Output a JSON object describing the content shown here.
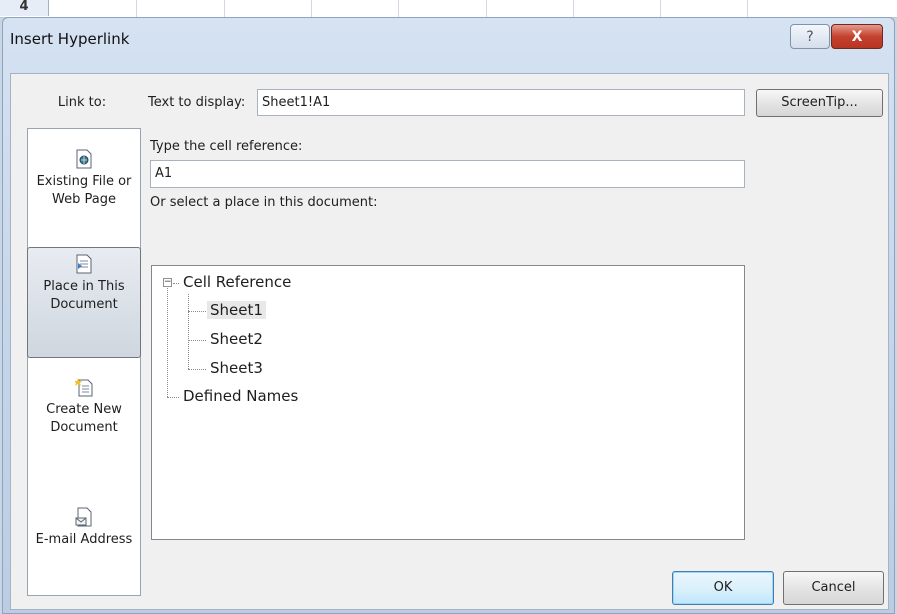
{
  "background_sheet": {
    "row_number": "4"
  },
  "window": {
    "title": "Insert Hyperlink",
    "help_label": "?",
    "close_label": "X"
  },
  "link_to": {
    "label": "Link to:",
    "items": [
      {
        "line1": "Existing File or",
        "line2": "Web Page",
        "icon": "web-page-icon",
        "selected": false
      },
      {
        "line1": "Place in This",
        "line2": "Document",
        "icon": "document-icon",
        "selected": true
      },
      {
        "line1": "Create New",
        "line2": "Document",
        "icon": "new-document-icon",
        "selected": false
      },
      {
        "line1": "E-mail Address",
        "line2": "",
        "icon": "email-icon",
        "selected": false
      }
    ]
  },
  "text_to_display": {
    "label": "Text to display:",
    "value": "Sheet1!A1"
  },
  "screentip_button": "ScreenTip...",
  "cell_reference": {
    "label": "Type the cell reference:",
    "value": "A1"
  },
  "place_select": {
    "label": "Or select a place in this document:",
    "tree": {
      "root": "Cell Reference",
      "expander": "−",
      "sheets": [
        "Sheet1",
        "Sheet2",
        "Sheet3"
      ],
      "selected": "Sheet1",
      "defined_names": "Defined Names"
    }
  },
  "buttons": {
    "ok": "OK",
    "cancel": "Cancel"
  }
}
